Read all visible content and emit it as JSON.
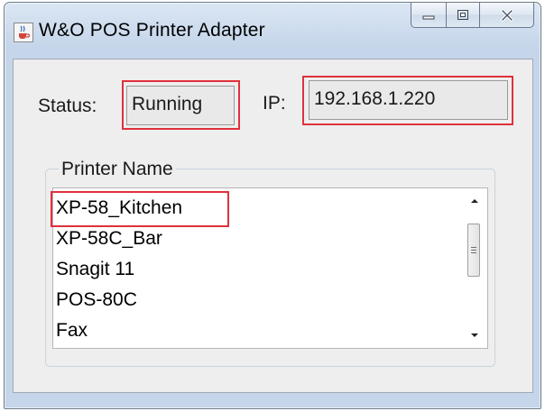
{
  "window": {
    "title": "W&O POS Printer Adapter",
    "app_icon": "java-cup-icon",
    "caption_buttons": [
      "minimize-icon",
      "maximize-icon",
      "close-icon"
    ]
  },
  "status": {
    "label": "Status:",
    "value": "Running"
  },
  "ip": {
    "label": "IP:",
    "value": "192.168.1.220"
  },
  "printers": {
    "group_label": "Printer Name",
    "items": [
      "XP-58_Kitchen",
      "XP-58C_Bar",
      "Snagit 11",
      "POS-80C",
      "Fax"
    ],
    "highlighted": "XP-58_Kitchen"
  },
  "colors": {
    "highlight_box": "#e0313b",
    "titlebar": "#c9d9ec",
    "client_bg": "#eeeeee"
  }
}
